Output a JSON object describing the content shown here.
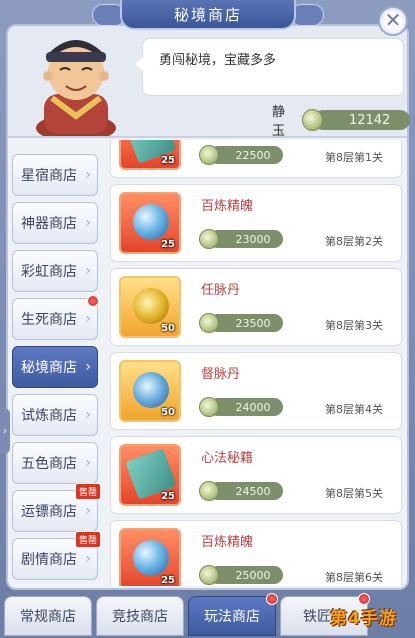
{
  "title": "秘境商店",
  "close_glyph": "✕",
  "npc": {
    "speech": "勇闯秘境，宝藏多多",
    "currency_label": "静玉",
    "currency_value": "12142",
    "currency_icon": "jade-coin-icon"
  },
  "side_tabs": [
    {
      "label": "星宿商店",
      "active": false,
      "badge": null
    },
    {
      "label": "神器商店",
      "active": false,
      "badge": null
    },
    {
      "label": "彩虹商店",
      "active": false,
      "badge": null
    },
    {
      "label": "生死商店",
      "active": false,
      "badge": "red-dot"
    },
    {
      "label": "秘境商店",
      "active": true,
      "badge": null
    },
    {
      "label": "试炼商店",
      "active": false,
      "badge": null
    },
    {
      "label": "五色商店",
      "active": false,
      "badge": null
    },
    {
      "label": "运镖商店",
      "active": false,
      "badge": "售罄"
    },
    {
      "label": "剧情商店",
      "active": false,
      "badge": "售罄"
    }
  ],
  "items": [
    {
      "name": "",
      "qty": "25",
      "price": "22500",
      "floor": "第8层第1关",
      "icon": "scroll-icon",
      "bg": "red"
    },
    {
      "name": "百炼精魄",
      "qty": "25",
      "price": "23000",
      "floor": "第8层第2关",
      "icon": "blue-orb-icon",
      "bg": "red"
    },
    {
      "name": "任脉丹",
      "qty": "50",
      "price": "23500",
      "floor": "第8层第3关",
      "icon": "gold-pill-icon",
      "bg": "gold"
    },
    {
      "name": "督脉丹",
      "qty": "50",
      "price": "24000",
      "floor": "第8层第4关",
      "icon": "blue-pill-icon",
      "bg": "gold"
    },
    {
      "name": "心法秘籍",
      "qty": "25",
      "price": "24500",
      "floor": "第8层第5关",
      "icon": "scroll-icon",
      "bg": "red"
    },
    {
      "name": "百炼精魄",
      "qty": "25",
      "price": "25000",
      "floor": "第8层第6关",
      "icon": "blue-orb-icon",
      "bg": "red"
    }
  ],
  "bottom_tabs": [
    {
      "label": "常规商店",
      "active": false,
      "dot": false
    },
    {
      "label": "竞技商店",
      "active": false,
      "dot": false
    },
    {
      "label": "玩法商店",
      "active": true,
      "dot": true
    },
    {
      "label": "铁匠铺",
      "active": false,
      "dot": true
    }
  ],
  "watermark": "第4手游"
}
